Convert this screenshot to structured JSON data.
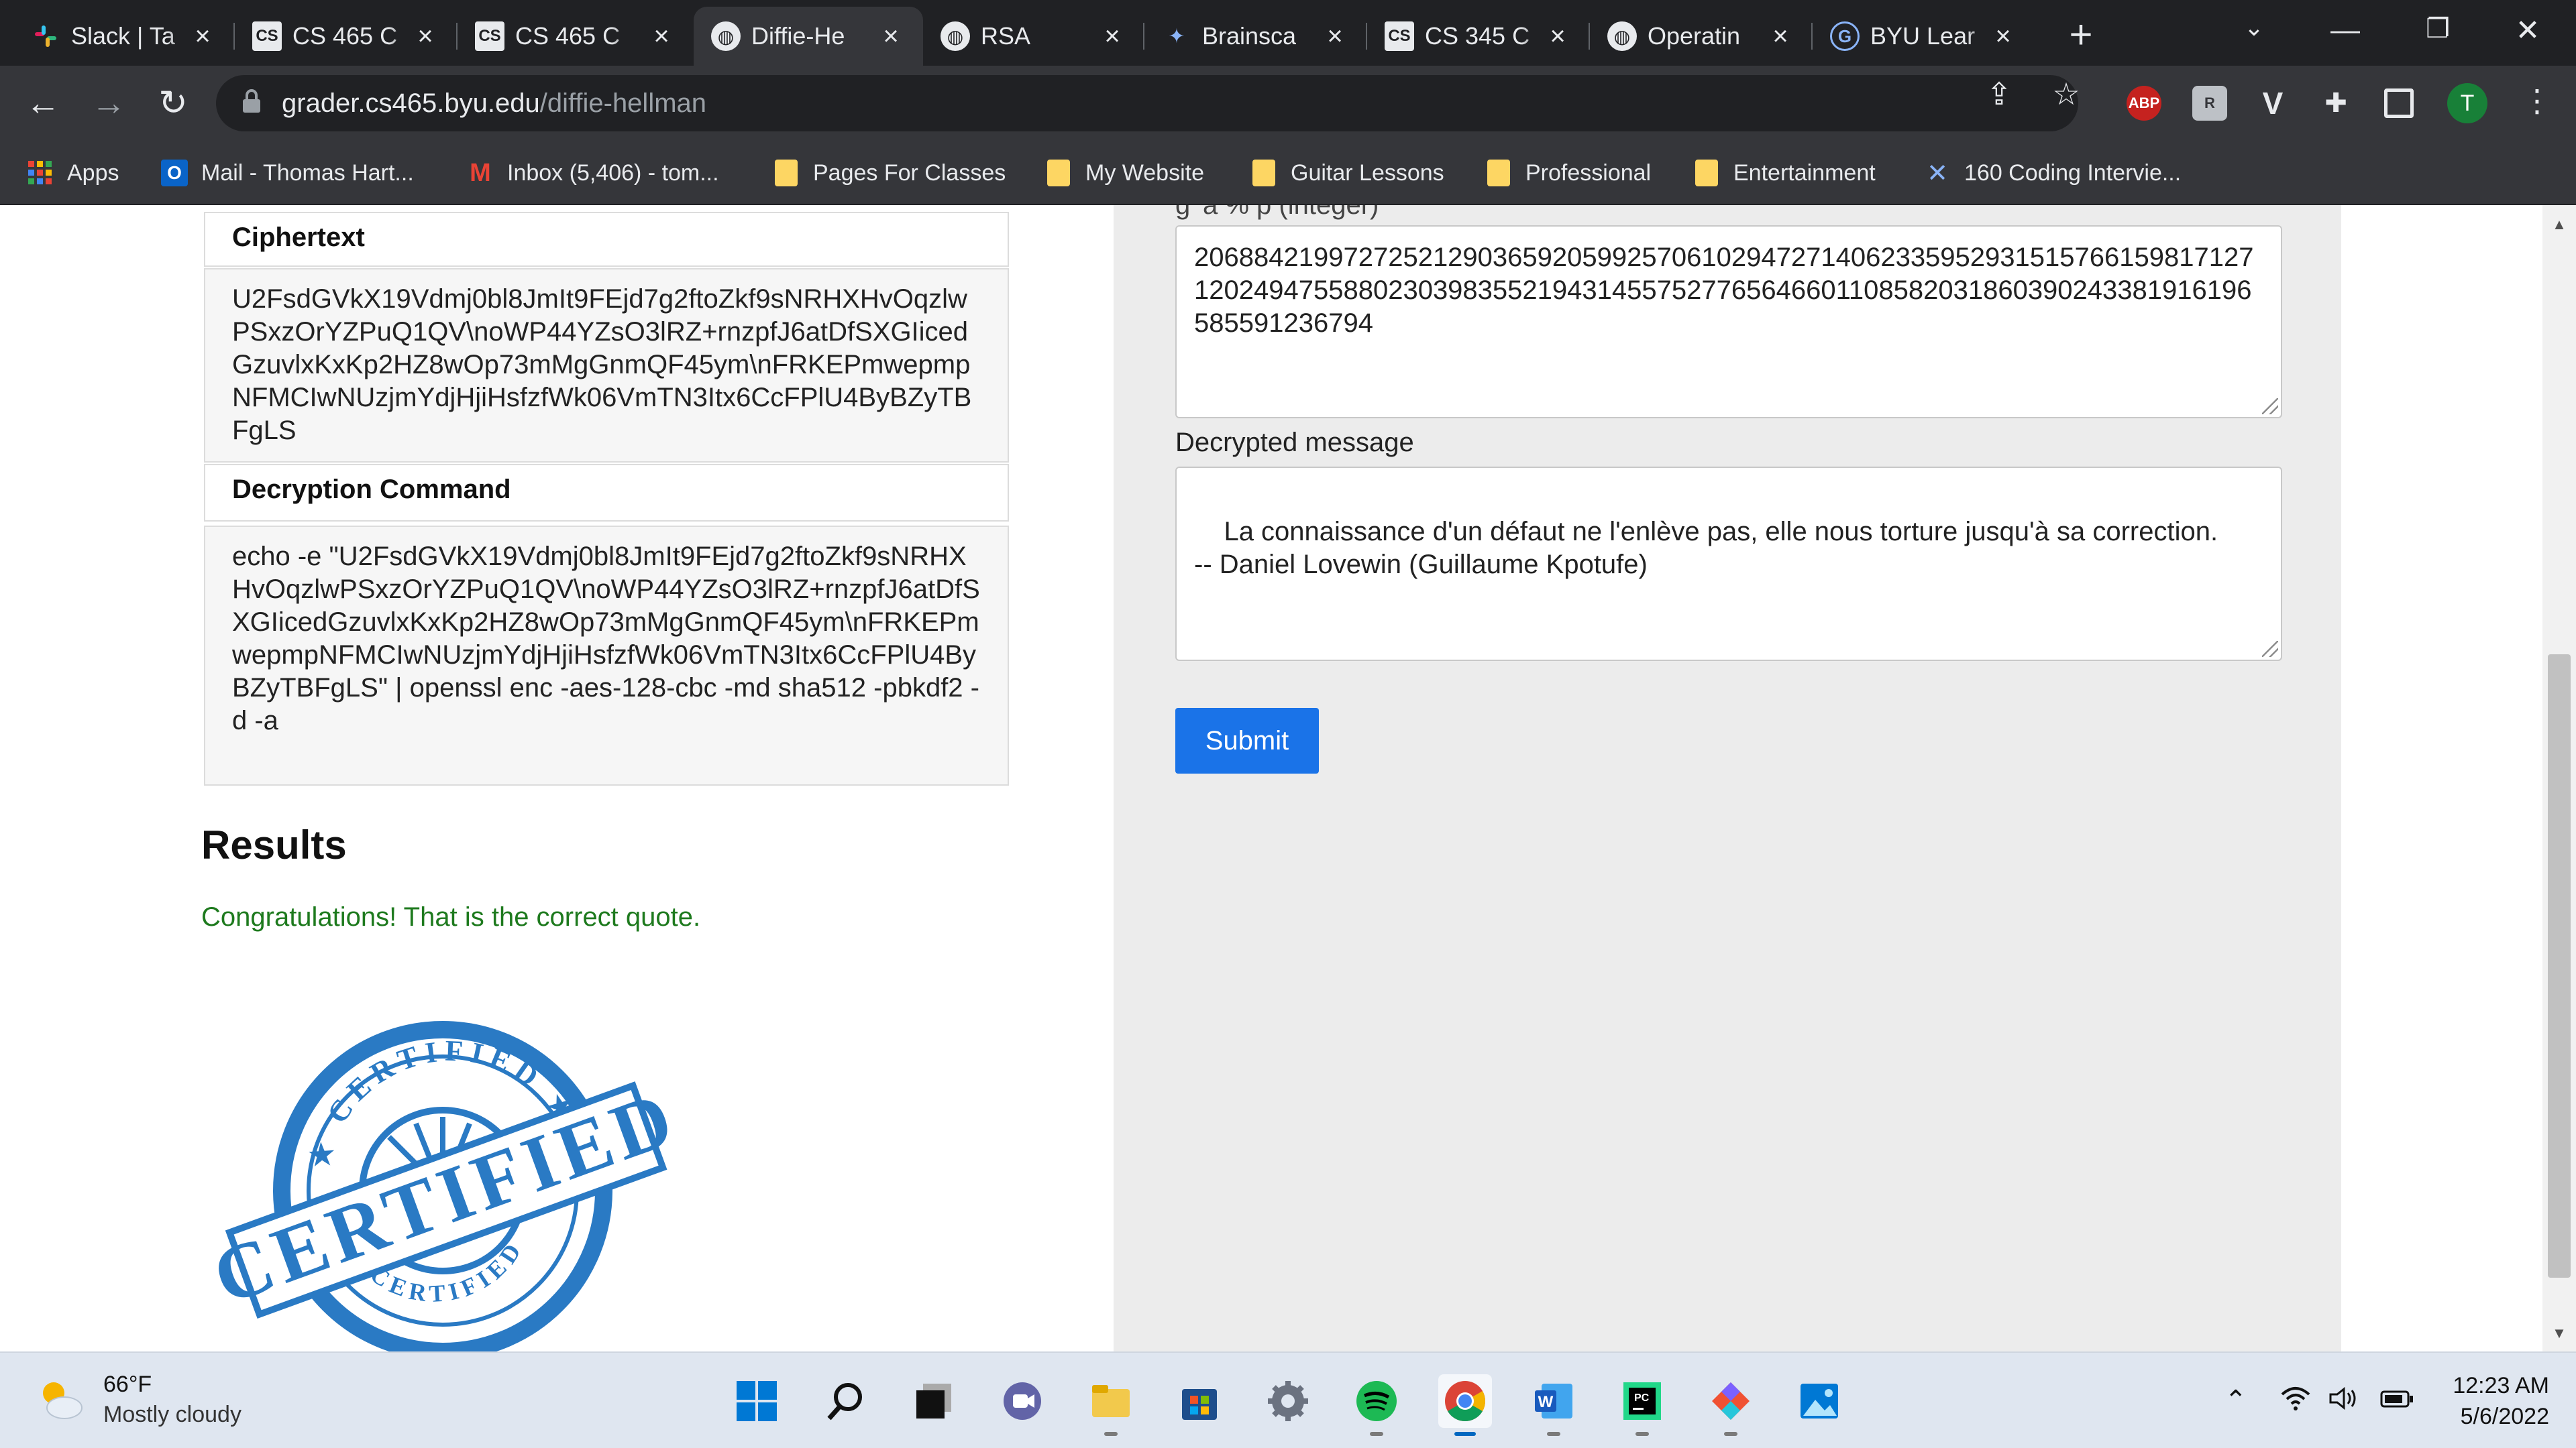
{
  "tabs": [
    {
      "title": "Slack | Ta",
      "icon": "slack-icon",
      "fav": "#"
    },
    {
      "title": "CS 465 C",
      "icon": "cs-icon",
      "fav": "CS"
    },
    {
      "title": "CS 465 C",
      "icon": "cs-icon",
      "fav": "CS"
    },
    {
      "title": "Diffie-He",
      "icon": "globe-icon",
      "fav": "◍"
    },
    {
      "title": "RSA",
      "icon": "globe-icon",
      "fav": "◍"
    },
    {
      "title": "Brainsca",
      "icon": "brainscape-icon",
      "fav": "✦"
    },
    {
      "title": "CS 345 C",
      "icon": "cs-icon",
      "fav": "CS"
    },
    {
      "title": "Operatin",
      "icon": "globe-icon",
      "fav": "◍"
    },
    {
      "title": "BYU Lear",
      "icon": "byu-learning-icon",
      "fav": "G"
    }
  ],
  "address": {
    "host": "grader.cs465.byu.edu",
    "path": "/diffie-hellman"
  },
  "bookmarks": [
    {
      "label": "Apps",
      "icon": "apps-grid-icon"
    },
    {
      "label": "Mail - Thomas Hart...",
      "icon": "outlook-icon"
    },
    {
      "label": "Inbox (5,406) - tom...",
      "icon": "gmail-icon"
    },
    {
      "label": "Pages For Classes",
      "icon": "folder-icon"
    },
    {
      "label": "My Website",
      "icon": "folder-icon"
    },
    {
      "label": "Guitar Lessons",
      "icon": "folder-icon"
    },
    {
      "label": "Professional",
      "icon": "folder-icon"
    },
    {
      "label": "Entertainment",
      "icon": "folder-icon"
    },
    {
      "label": "160 Coding Intervie...",
      "icon": "coding-site-icon"
    }
  ],
  "left": {
    "ciphertext_header": "Ciphertext",
    "ciphertext": "U2FsdGVkX19Vdmj0bl8JmIt9FEjd7g2ftoZkf9sNRHXHvOqzlwPSxzOrYZPuQ1QV\\noWP44YZsO3lRZ+rnzpfJ6atDfSXGIicedGzuvlxKxKp2HZ8wOp73mMgGnmQF45ym\\nFRKEPmwepmpNFMCIwNUzjmYdjHjiHsfzfWk06VmTN3Itx6CcFPlU4ByBZyTBFgLS",
    "decryption_header": "Decryption Command",
    "decryption_command": "echo -e \"U2FsdGVkX19Vdmj0bl8JmIt9FEjd7g2ftoZkf9sNRHXHvOqzlwPSxzOrYZPuQ1QV\\noWP44YZsO3lRZ+rnzpfJ6atDfSXGIicedGzuvlxKxKp2HZ8wOp73mMgGnmQF45ym\\nFRKEPmwepmpNFMCIwNUzjmYdjHjiHsfzfWk06VmTN3Itx6CcFPlU4ByBZyTBFgLS\" | openssl enc -aes-128-cbc -md sha512 -pbkdf2 -d -a",
    "results_title": "Results",
    "results_message": "Congratulations! That is the correct quote.",
    "stamp_text": "CERTIFIED"
  },
  "right": {
    "partial_label": "g^a % p (integer)",
    "integer_value": "20688421997272521290365920599257061029472714062335952931515766159817127120249475588023039835521943145575277656466011085820318603902433819161​96585591236794",
    "decrypted_label": "Decrypted message",
    "decrypted_message": "La connaissance d'un défaut ne l'enlève pas, elle nous torture jusqu'à sa correction.\n-- Daniel Lovewin (Guillaume Kpotufe)",
    "submit_label": "Submit"
  },
  "taskbar": {
    "temp": "66°F",
    "weather": "Mostly cloudy",
    "time": "12:23 AM",
    "date": "5/6/2022"
  },
  "colors": {
    "submit": "#1a73e8",
    "success": "#1e7a1e",
    "stamp": "#2a7ac4"
  }
}
